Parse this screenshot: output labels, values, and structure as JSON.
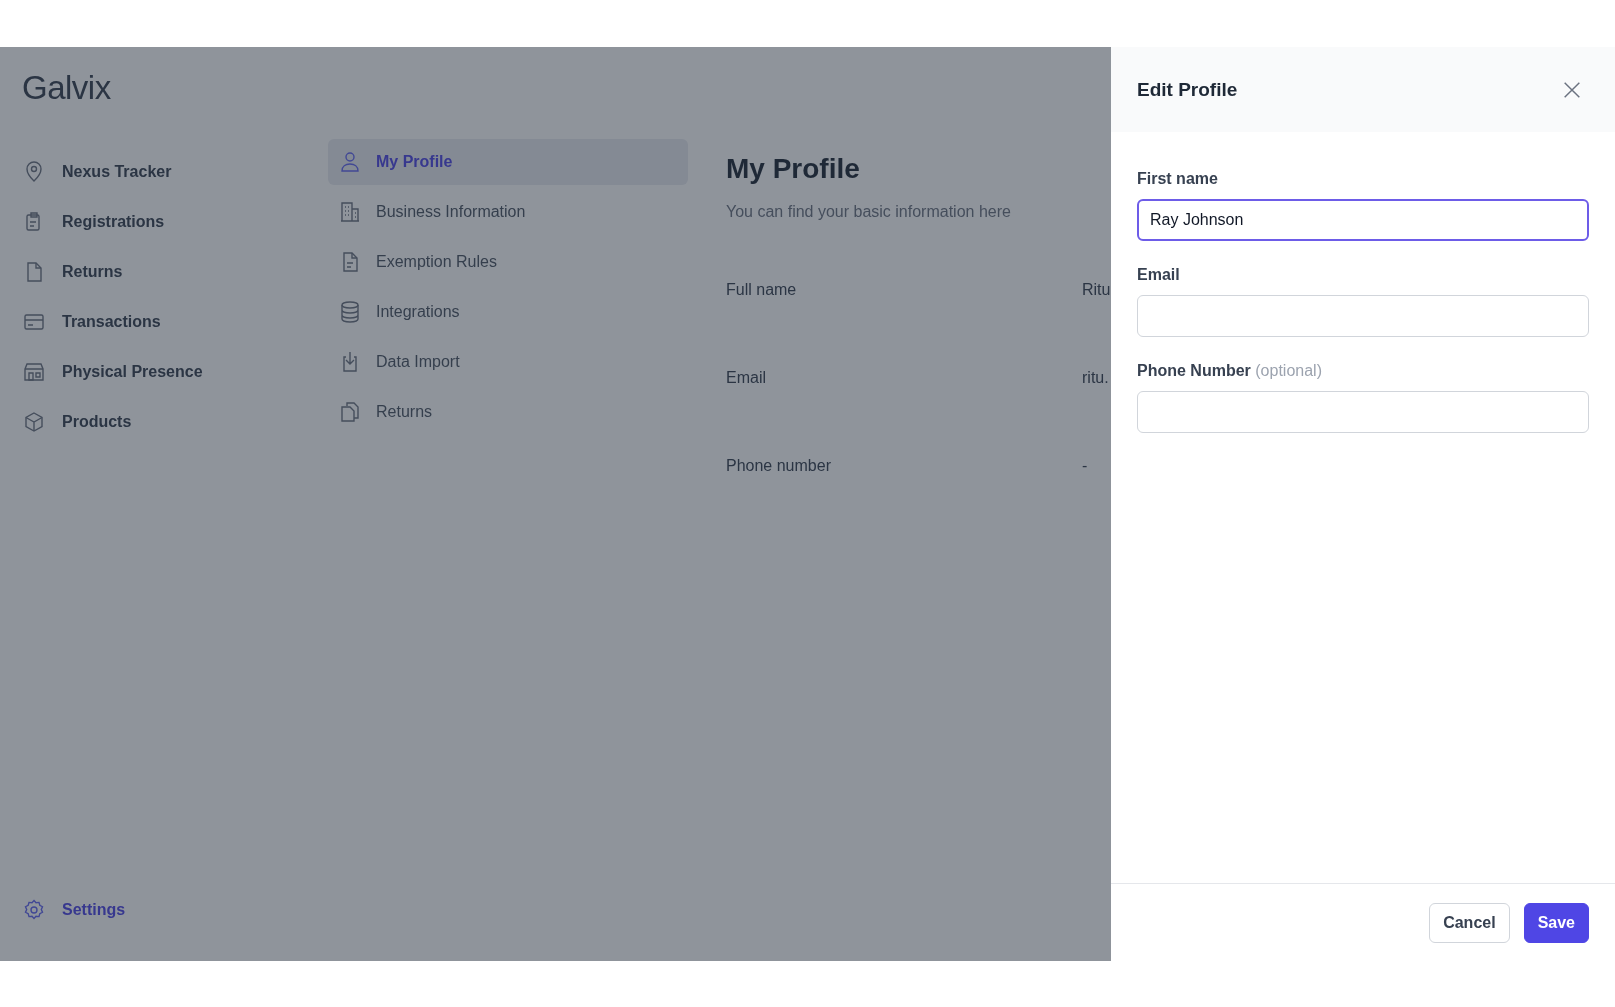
{
  "logo": "Galvix",
  "sidebar": {
    "items": [
      {
        "label": "Nexus Tracker",
        "selected": false
      },
      {
        "label": "Registrations",
        "selected": false
      },
      {
        "label": "Returns",
        "selected": false
      },
      {
        "label": "Transactions",
        "selected": false
      },
      {
        "label": "Physical Presence",
        "selected": false
      },
      {
        "label": "Products",
        "selected": false
      }
    ],
    "footer": {
      "label": "Settings",
      "selected": true
    }
  },
  "settings_menu": {
    "items": [
      {
        "label": "My Profile",
        "selected": true
      },
      {
        "label": "Business Information",
        "selected": false
      },
      {
        "label": "Exemption Rules",
        "selected": false
      },
      {
        "label": "Integrations",
        "selected": false
      },
      {
        "label": "Data Import",
        "selected": false
      },
      {
        "label": "Returns",
        "selected": false
      }
    ]
  },
  "profile": {
    "title": "My Profile",
    "subtitle": "You can find your basic information here",
    "rows": [
      {
        "label": "Full name",
        "value": "Ritu"
      },
      {
        "label": "Email",
        "value": "ritu."
      },
      {
        "label": "Phone number",
        "value": "-"
      }
    ]
  },
  "drawer": {
    "title": "Edit Profile",
    "fields": [
      {
        "label": "First name",
        "value": "Ray Johnson",
        "focused": true
      },
      {
        "label": "Email",
        "focused": false
      },
      {
        "label": "Phone Number",
        "hint": "(optional)",
        "focused": false
      }
    ],
    "buttons": [
      {
        "label": "Cancel",
        "kind": "secondary"
      },
      {
        "label": "Save",
        "kind": "primary"
      }
    ]
  }
}
